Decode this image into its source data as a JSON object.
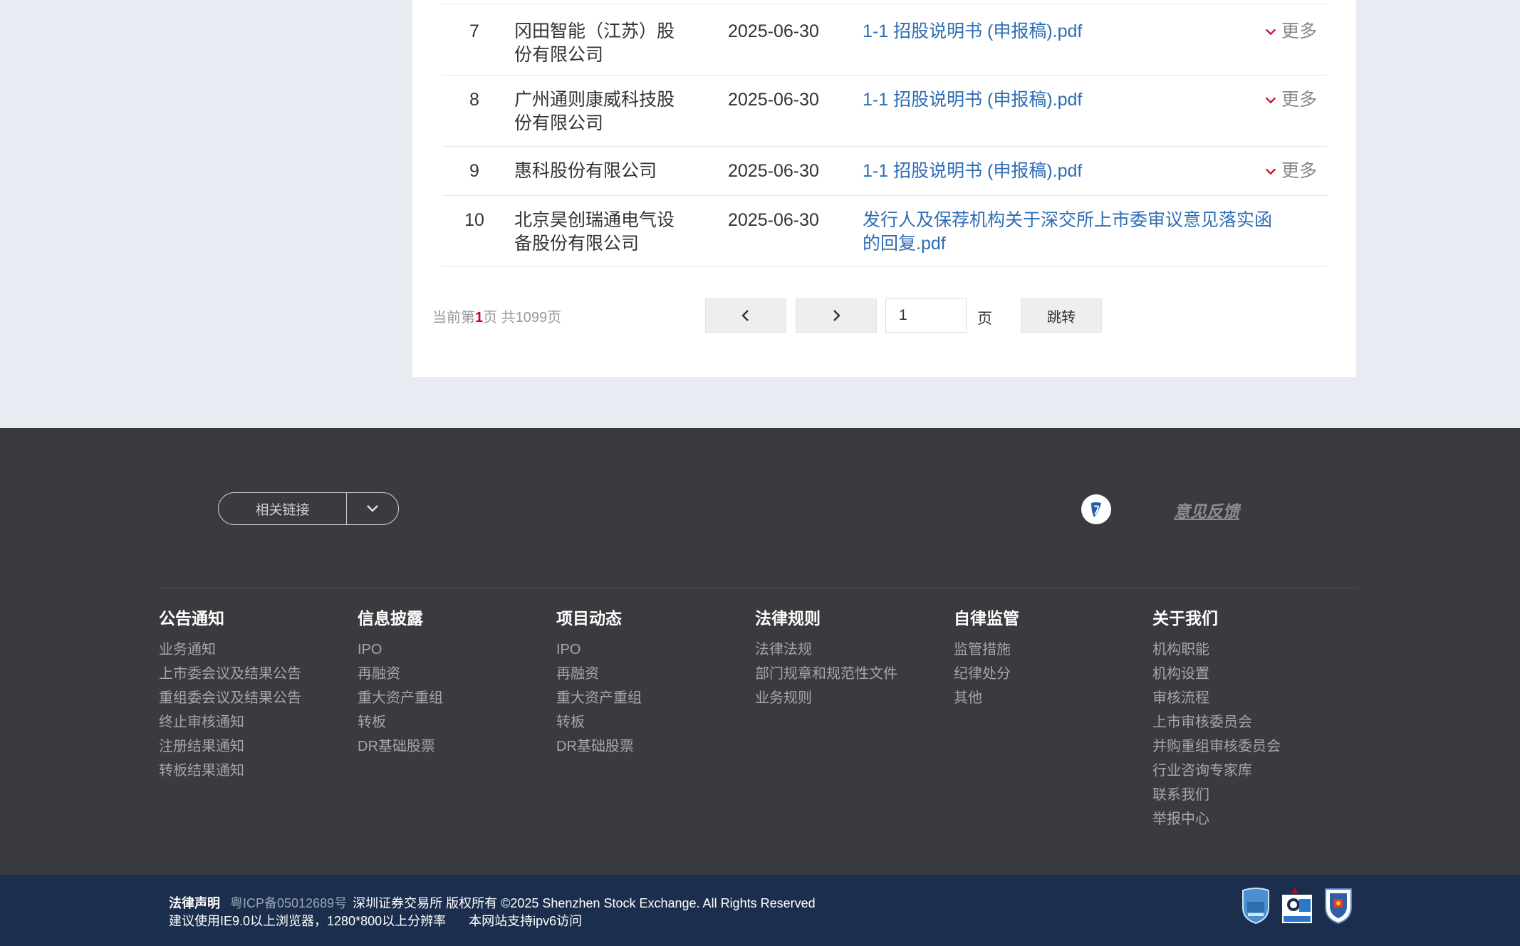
{
  "table": {
    "rows": [
      {
        "index": "7",
        "company": "冈田智能（江苏）股份有限公司",
        "date": "2025-06-30",
        "doc": "1-1 招股说明书 (申报稿).pdf",
        "more": "更多"
      },
      {
        "index": "8",
        "company": "广州通则康威科技股份有限公司",
        "date": "2025-06-30",
        "doc": "1-1 招股说明书 (申报稿).pdf",
        "more": "更多"
      },
      {
        "index": "9",
        "company": "惠科股份有限公司",
        "date": "2025-06-30",
        "doc": "1-1 招股说明书 (申报稿).pdf",
        "more": "更多"
      },
      {
        "index": "10",
        "company": "北京昊创瑞通电气设备股份有限公司",
        "date": "2025-06-30",
        "doc": "发行人及保荐机构关于深交所上市委审议意见落实函的回复.pdf",
        "more": ""
      }
    ]
  },
  "pager": {
    "prefix": "当前第",
    "current": "1",
    "middle": "页 共",
    "total": "1099",
    "suffix": "页",
    "input_value": "1",
    "page_unit": "页",
    "jump_label": "跳转"
  },
  "footer": {
    "links_select_label": "相关链接",
    "feedback_label": "意见反馈",
    "columns": [
      {
        "title": "公告通知",
        "items": [
          "业务通知",
          "上市委会议及结果公告",
          "重组委会议及结果公告",
          "终止审核通知",
          "注册结果通知",
          "转板结果通知"
        ]
      },
      {
        "title": "信息披露",
        "items": [
          "IPO",
          "再融资",
          "重大资产重组",
          "转板",
          "DR基础股票"
        ]
      },
      {
        "title": "项目动态",
        "items": [
          "IPO",
          "再融资",
          "重大资产重组",
          "转板",
          "DR基础股票"
        ]
      },
      {
        "title": "法律规则",
        "items": [
          "法律法规",
          "部门规章和规范性文件",
          "业务规则"
        ]
      },
      {
        "title": "自律监管",
        "items": [
          "监管措施",
          "纪律处分",
          "其他"
        ]
      },
      {
        "title": "关于我们",
        "items": [
          "机构职能",
          "机构设置",
          "审核流程",
          "上市审核委员会",
          "并购重组审核委员会",
          "行业咨询专家库",
          "联系我们",
          "举报中心"
        ]
      }
    ]
  },
  "bottom": {
    "legal": "法律声明",
    "icp": "粤ICP备05012689号",
    "copyright": "深圳证券交易所 版权所有 ©2025 Shenzhen Stock Exchange. All Rights Reserved",
    "browser_tip": "建议使用IE9.0以上浏览器，1280*800以上分辨率",
    "ipv6_tip": "本网站支持ipv6访问"
  },
  "colors": {
    "link_blue": "#2f6db5",
    "accent_red": "#d0021b",
    "footer_bg": "#3a3b3f",
    "bottom_bg": "#1c2e4d",
    "page_bg": "#e8ebf1"
  }
}
